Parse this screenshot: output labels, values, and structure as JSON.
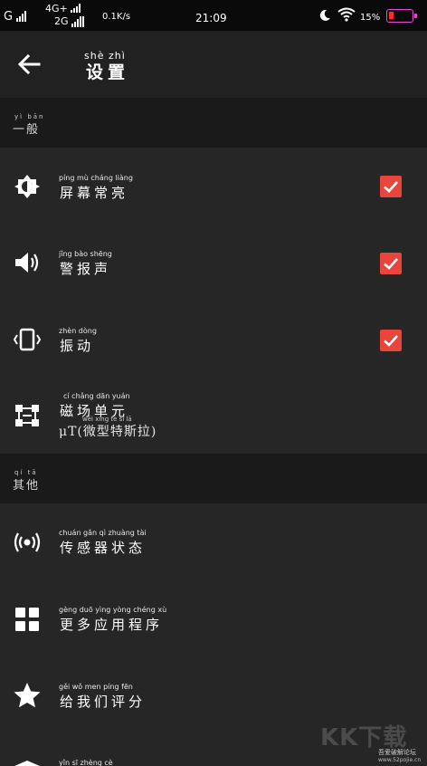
{
  "status_bar": {
    "carrier_1": "G",
    "net_4g": "4G+",
    "net_2g": "2G",
    "speed": "0.1K/s",
    "time": "21:09",
    "battery": "15%",
    "battery_level_pct": 15,
    "icons": [
      "signal-icon",
      "moon-icon",
      "wifi-icon",
      "battery-icon"
    ]
  },
  "toolbar": {
    "back_icon": "arrow-left-icon",
    "title_pinyin": "shè zhì",
    "title": "设置"
  },
  "sections": [
    {
      "pinyin": "yì bān",
      "title": "一般",
      "items": [
        {
          "icon": "brightness-icon",
          "pinyin": "píng mù cháng liàng",
          "label": "屏幕常亮",
          "checked": true
        },
        {
          "icon": "volume-icon",
          "pinyin": "jǐng bào shēng",
          "label": "警报声",
          "checked": true
        },
        {
          "icon": "vibrate-icon",
          "pinyin": "zhèn dòng",
          "label": "振动",
          "checked": true
        },
        {
          "icon": "magnet-unit-icon",
          "pinyin": "cí chǎng dān yuán",
          "label": "磁场单元",
          "value_pinyin": "wēi xíng tè sī lā",
          "value": "μT(微型特斯拉)"
        }
      ]
    },
    {
      "pinyin": "qí tā",
      "title": "其他",
      "items": [
        {
          "icon": "sensor-status-icon",
          "pinyin": "chuán gǎn qì zhuàng tài",
          "label": "传感器状态"
        },
        {
          "icon": "more-apps-icon",
          "pinyin": "gèng duō yìng yòng chéng xù",
          "label": "更多应用程序"
        },
        {
          "icon": "star-icon",
          "pinyin": "gěi wǒ men píng fēn",
          "label": "给我们评分"
        },
        {
          "icon": "privacy-icon",
          "pinyin": "yǐn sī zhèng cè",
          "label": ""
        }
      ]
    }
  ],
  "watermark": {
    "logo_text": "KK下载",
    "site_name": "吾爱破解论坛",
    "site_url": "www.52pojie.cn"
  },
  "colors": {
    "background": "#262626",
    "section_header": "#1a1a1a",
    "toolbar": "#212121",
    "status_bar": "#0a0a0a",
    "checkbox_accent": "#e8453c"
  }
}
